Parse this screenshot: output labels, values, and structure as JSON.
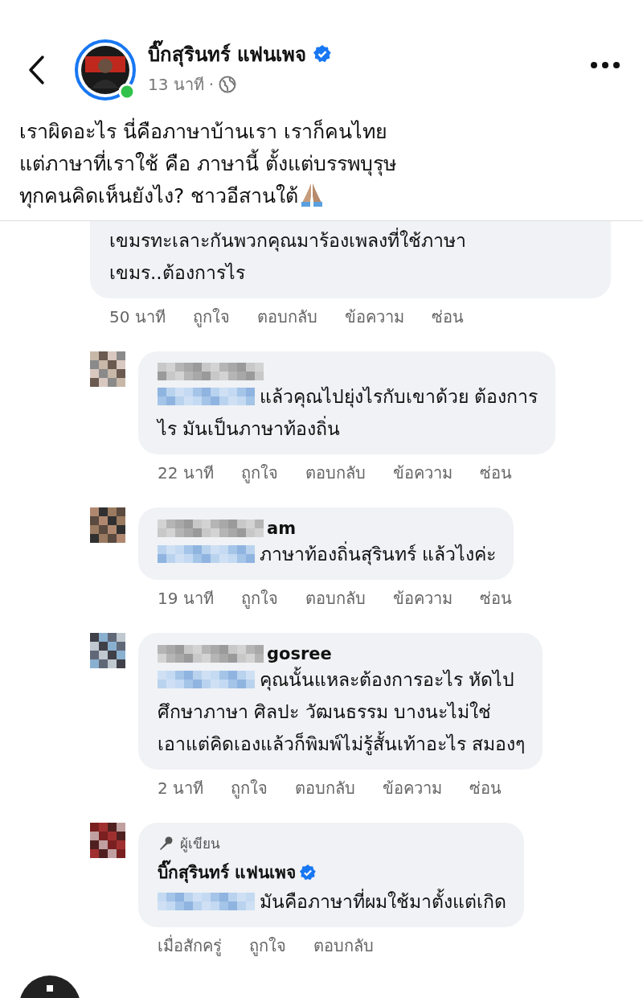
{
  "header": {
    "page_name": "บิ๊กสุรินทร์ แฟนเพจ",
    "verified": true,
    "online": true,
    "time": "13 นาที",
    "separator": "·"
  },
  "post": {
    "text": "เราผิดอะไร นี่คือภาษาบ้านเรา เราก็คนไทย\nแต่ภาษาที่เราใช้ คือ ภาษานี้ ตั้งแต่บรรพบุรุษ\nทุกคนคิดเห็นยังไง? ชาวอีสานใต้"
  },
  "comments": [
    {
      "kind": "top",
      "text": "เขมรทะเลาะกันพวกคุณมาร้องเพลงที่ใช้ภาษา\nเขมร..ต้องการไร",
      "time": "50 นาที",
      "actions": [
        "ถูกใจ",
        "ตอบกลับ",
        "ข้อความ",
        "ซ่อน"
      ]
    },
    {
      "kind": "reply",
      "mention_hidden": true,
      "text": "แล้วคุณไปยุ่งไรกับเขาด้วย ต้องการ\nไร มันเป็นภาษาท้องถิ่น",
      "time": "22 นาที",
      "actions": [
        "ถูกใจ",
        "ตอบกลับ",
        "ข้อความ",
        "ซ่อน"
      ]
    },
    {
      "kind": "reply",
      "name_tail": "am",
      "mention_hidden": true,
      "text": "ภาษาท้องถิ่นสุรินทร์ แล้วไงค่ะ",
      "time": "19 นาที",
      "actions": [
        "ถูกใจ",
        "ตอบกลับ",
        "ข้อความ",
        "ซ่อน"
      ]
    },
    {
      "kind": "reply",
      "name_tail": "gosree",
      "mention_hidden": true,
      "text": "คุณนั้นแหละต้องการอะไร หัดไป\nศึกษาภาษา ศิลปะ วัฒนธรรม บางนะไม่ใช่\nเอาแต่คิดเองแล้วก็พิมพ์ไม่รู้สั้นเท้าอะไร สมองๆ",
      "time": "2 นาที",
      "actions": [
        "ถูกใจ",
        "ตอบกลับ",
        "ข้อความ",
        "ซ่อน"
      ]
    },
    {
      "kind": "author",
      "badge": "ผู้เขียน",
      "name": "บิ๊กสุรินทร์ แฟนเพจ",
      "verified": true,
      "mention_hidden": true,
      "text": "มันคือภาษาที่ผมใช้มาตั้งแต่เกิด",
      "time": "เมื่อสักครู่",
      "actions": [
        "ถูกใจ",
        "ตอบกลับ"
      ]
    }
  ]
}
